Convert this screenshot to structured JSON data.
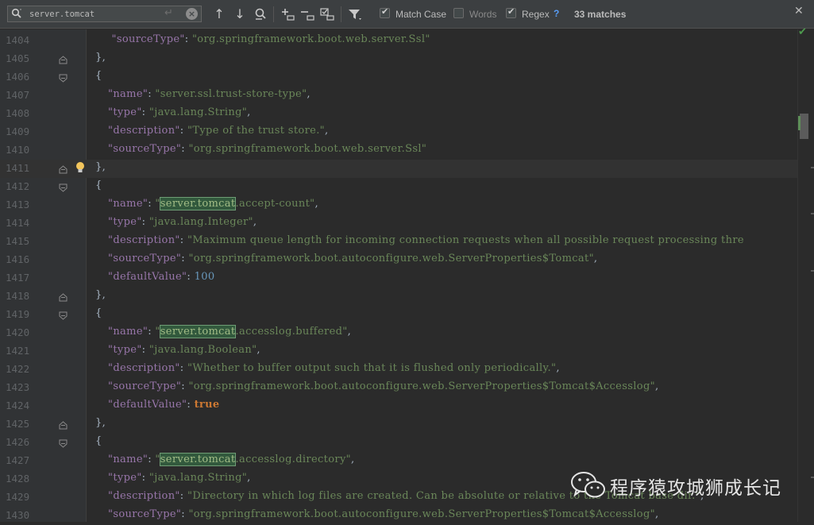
{
  "find_bar": {
    "search_value": "server.tomcat",
    "match_case_label": "Match Case",
    "match_case_checked": true,
    "words_label": "Words",
    "words_checked": false,
    "regex_label": "Regex",
    "regex_checked": true,
    "help_label": "?",
    "matches_label": "33 matches"
  },
  "editor": {
    "lines": [
      {
        "n": "1404",
        "html": "<span class=\"c1\"> <span class=\"k\">\"sourceType\"</span>: <span class=\"s\">\"org.springframework.boot.web.server.Ssl\"</span></span>"
      },
      {
        "n": "1405",
        "html": "},",
        "fold": "end"
      },
      {
        "n": "1406",
        "html": "{",
        "fold": "start"
      },
      {
        "n": "1407",
        "html": "<span class=\"c1\"><span class=\"k\">\"name\"</span>: <span class=\"s\">\"server.ssl.trust-store-type\"</span>,</span>"
      },
      {
        "n": "1408",
        "html": "<span class=\"c1\"><span class=\"k\">\"type\"</span>: <span class=\"s\">\"java.lang.String\"</span>,</span>"
      },
      {
        "n": "1409",
        "html": "<span class=\"c1\"><span class=\"k\">\"description\"</span>: <span class=\"s\">\"Type of the trust store.\"</span>,</span>"
      },
      {
        "n": "1410",
        "html": "<span class=\"c1\"><span class=\"k\">\"sourceType\"</span>: <span class=\"s\">\"org.springframework.boot.web.server.Ssl\"</span></span>"
      },
      {
        "n": "1411",
        "html": "},",
        "fold": "end",
        "caret": true,
        "bulb": true
      },
      {
        "n": "1412",
        "html": "{",
        "fold": "start"
      },
      {
        "n": "1413",
        "html": "<span class=\"c1\"><span class=\"k\">\"name\"</span>: <span class=\"s\">\"<span class=\"hl\">server.tomcat</span>.accept-count\"</span>,</span>"
      },
      {
        "n": "1414",
        "html": "<span class=\"c1\"><span class=\"k\">\"type\"</span>: <span class=\"s\">\"java.lang.Integer\"</span>,</span>"
      },
      {
        "n": "1415",
        "html": "<span class=\"c1\"><span class=\"k\">\"description\"</span>: <span class=\"s\">\"Maximum queue length for incoming connection requests when all possible request processing thre</span></span>"
      },
      {
        "n": "1416",
        "html": "<span class=\"c1\"><span class=\"k\">\"sourceType\"</span>: <span class=\"s\">\"org.springframework.boot.autoconfigure.web.ServerProperties$Tomcat\"</span>,</span>"
      },
      {
        "n": "1417",
        "html": "<span class=\"c1\"><span class=\"k\">\"defaultValue\"</span>: <span class=\"n\">100</span></span>"
      },
      {
        "n": "1418",
        "html": "},",
        "fold": "end"
      },
      {
        "n": "1419",
        "html": "{",
        "fold": "start"
      },
      {
        "n": "1420",
        "html": "<span class=\"c1\"><span class=\"k\">\"name\"</span>: <span class=\"s\">\"<span class=\"hl\">server.tomcat</span>.accesslog.buffered\"</span>,</span>"
      },
      {
        "n": "1421",
        "html": "<span class=\"c1\"><span class=\"k\">\"type\"</span>: <span class=\"s\">\"java.lang.Boolean\"</span>,</span>"
      },
      {
        "n": "1422",
        "html": "<span class=\"c1\"><span class=\"k\">\"description\"</span>: <span class=\"s\">\"Whether to buffer output such that it is flushed only periodically.\"</span>,</span>"
      },
      {
        "n": "1423",
        "html": "<span class=\"c1\"><span class=\"k\">\"sourceType\"</span>: <span class=\"s\">\"org.springframework.boot.autoconfigure.web.ServerProperties$Tomcat$Accesslog\"</span>,</span>"
      },
      {
        "n": "1424",
        "html": "<span class=\"c1\"><span class=\"k\">\"defaultValue\"</span>: <span class=\"b\">true</span></span>"
      },
      {
        "n": "1425",
        "html": "},",
        "fold": "end"
      },
      {
        "n": "1426",
        "html": "{",
        "fold": "start"
      },
      {
        "n": "1427",
        "html": "<span class=\"c1\"><span class=\"k\">\"name\"</span>: <span class=\"s\">\"<span class=\"hl\">server.tomcat</span>.accesslog.directory\"</span>,</span>"
      },
      {
        "n": "1428",
        "html": "<span class=\"c1\"><span class=\"k\">\"type\"</span>: <span class=\"s\">\"java.lang.String\"</span>,</span>"
      },
      {
        "n": "1429",
        "html": "<span class=\"c1\"><span class=\"k\">\"description\"</span>: <span class=\"s\">\"Directory in which log files are created. Can be absolute or relative to the Tomcat base dir.\"</span>,</span>"
      },
      {
        "n": "1430",
        "html": "<span class=\"c1\"><span class=\"k\">\"sourceType\"</span>: <span class=\"s\">\"org.springframework.boot.autoconfigure.web.ServerProperties$Tomcat$Accesslog\"</span>,</span>"
      }
    ]
  },
  "watermark": {
    "text": "程序猿攻城狮成长记",
    "icon": "wechat-icon"
  },
  "icons": {
    "search": "search-icon",
    "prev": "arrow-up-icon",
    "next": "arrow-down-icon",
    "find_all": "find-all-icon",
    "add_occurrence": "add-occurrence-icon",
    "remove_occurrence": "remove-occurrence-icon",
    "select_all_occurrences": "select-all-occurrences-icon",
    "filter": "filter-icon",
    "close": "close-icon"
  }
}
